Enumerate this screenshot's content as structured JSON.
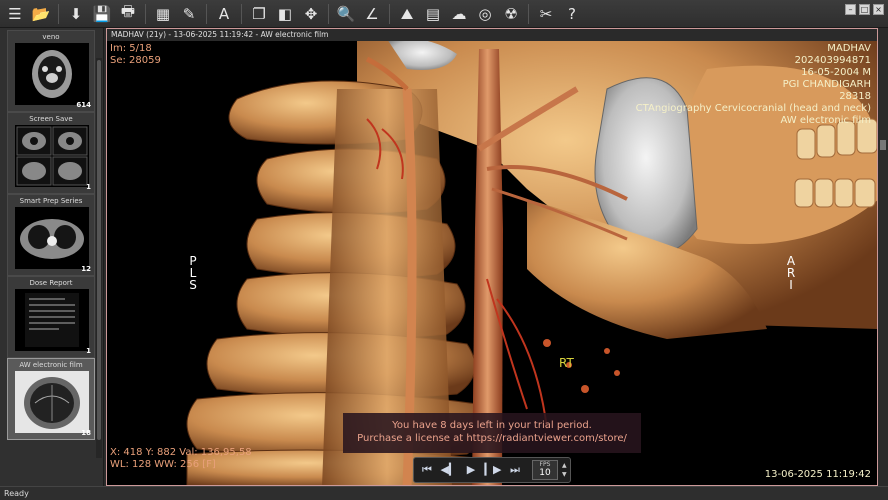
{
  "toolbar": {
    "items": [
      {
        "name": "menu-icon",
        "glyph": "☰"
      },
      {
        "name": "open-folder-icon",
        "glyph": "📂"
      },
      {
        "name": "download-icon",
        "glyph": "⬇"
      },
      {
        "name": "save-icon",
        "glyph": "💾"
      },
      {
        "name": "print-icon",
        "glyph": "🖶"
      },
      {
        "name": "layout-icon",
        "glyph": "▦"
      },
      {
        "name": "measure-tool-icon",
        "glyph": "✎"
      },
      {
        "name": "text-annotation-icon",
        "glyph": "A"
      },
      {
        "name": "series-stack-icon",
        "glyph": "❐"
      },
      {
        "name": "window-level-icon",
        "glyph": "◧"
      },
      {
        "name": "pan-move-icon",
        "glyph": "✥"
      },
      {
        "name": "zoom-icon",
        "glyph": "🔍"
      },
      {
        "name": "angle-tool-icon",
        "glyph": "∠"
      },
      {
        "name": "3d-volume-icon",
        "glyph": "⛰"
      },
      {
        "name": "film-card-icon",
        "glyph": "▤"
      },
      {
        "name": "cloud-icon",
        "glyph": "☁"
      },
      {
        "name": "sphere-icon",
        "glyph": "◎"
      },
      {
        "name": "dose-icon",
        "glyph": "☢"
      },
      {
        "name": "tools-icon",
        "glyph": "✂"
      },
      {
        "name": "help-icon",
        "glyph": "?"
      }
    ]
  },
  "series": [
    {
      "title": "veno",
      "count": "614"
    },
    {
      "title": "Screen Save",
      "count": "1"
    },
    {
      "title": "Smart Prep Series",
      "count": "12"
    },
    {
      "title": "Dose Report",
      "count": "1"
    },
    {
      "title": "AW electronic film",
      "count": "18"
    }
  ],
  "viewport": {
    "title": "MADHAV (21y) - 13-06-2025 11:19:42 - AW electronic film",
    "top_left": {
      "image": "Im: 5/18",
      "series": "Se: 28059"
    },
    "top_right": {
      "patient_name": "MADHAV",
      "patient_id": "202403994871",
      "birth_date": "16-05-2004 M",
      "institution": "PGI CHANDIGARH",
      "study_number": "28318",
      "study_description": "CTAngiography Cervicocranial (head and neck)",
      "series_description": "AW electronic film"
    },
    "bottom_left": {
      "coords": "X: 418 Y: 882 Val: 136,95,58",
      "window": "WL: 128 WW: 256 [F]"
    },
    "bottom_right": {
      "datetime": "13-06-2025 11:19:42"
    },
    "orientation_left": "PLS",
    "orientation_right": "ARI",
    "rt_label": "RT",
    "trial_notice": {
      "line1": "You have 8 days left in your trial period.",
      "line2": "Purchase a license at https://radiantviewer.com/store/"
    },
    "player": {
      "fps_label": "FPS",
      "fps_value": "10"
    }
  },
  "status": {
    "text": "Ready"
  },
  "colors": {
    "overlay_orange": "#e9a07a",
    "overlay_cream": "#f5f0c8",
    "rt_yellow": "#d8d23c"
  }
}
